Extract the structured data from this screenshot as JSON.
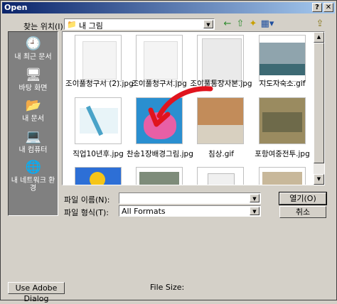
{
  "window": {
    "title": "Open",
    "help_glyph": "?",
    "close_glyph": "✕"
  },
  "lookin": {
    "label": "찾는 위치(I):",
    "value": "내 그림",
    "folder_glyph": "📁",
    "arrow_glyph": "▼"
  },
  "toolbar": {
    "back_glyph": "←",
    "up_glyph": "⇧",
    "newfolder_glyph": "✦",
    "views_glyph": "▦▾",
    "right_glyph": "⇪"
  },
  "places": [
    {
      "label": "내 최근 문서",
      "icon": "clock-icon",
      "glyph": "🕘"
    },
    {
      "label": "바탕 화면",
      "icon": "desktop-icon",
      "glyph": "🖥"
    },
    {
      "label": "내 문서",
      "icon": "folder-icon",
      "glyph": "📂"
    },
    {
      "label": "내 컴퓨터",
      "icon": "computer-icon",
      "glyph": "💻"
    },
    {
      "label": "내 네트워크 환경",
      "icon": "network-icon",
      "glyph": "🌐"
    }
  ],
  "files": {
    "row1": [
      "조이풀청구서 (2).jpg",
      "조이풀청구서.jpg",
      "조이풀통장사본.jpg",
      "지도자숙소.gif"
    ],
    "row2": [
      "직업10년후.jpg",
      "찬송1장배경그림.jpg",
      "침상.gif",
      "포항여중전투.jpg"
    ]
  },
  "filename": {
    "label": "파일 이름(N):",
    "value": "",
    "arrow_glyph": "▼"
  },
  "filetype": {
    "label": "파일 형식(T):",
    "value": "All Formats",
    "arrow_glyph": "▼"
  },
  "buttons": {
    "open": "열기(O)",
    "cancel": "취소",
    "adobe": "Use Adobe Dialog"
  },
  "scroll": {
    "up_glyph": "▲",
    "down_glyph": "▼"
  },
  "filesize_label": "File Size:"
}
